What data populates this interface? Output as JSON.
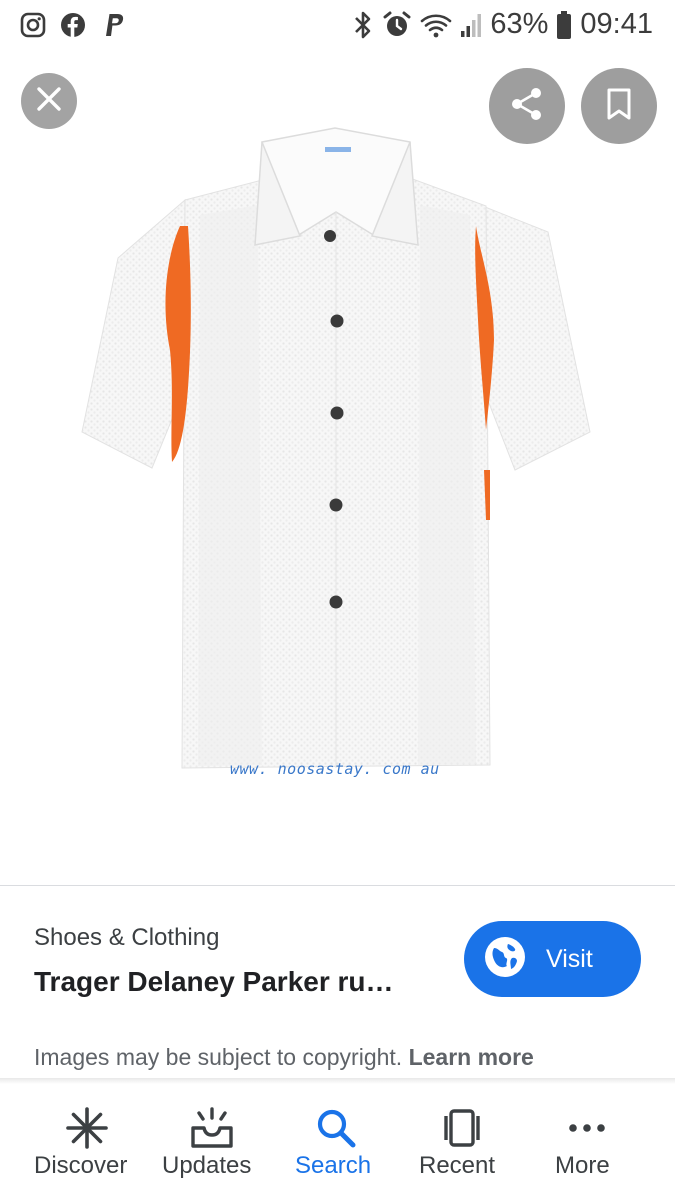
{
  "status_bar": {
    "left_icons": [
      "instagram-icon",
      "facebook-icon",
      "paypal-icon"
    ],
    "right_icons": [
      "bluetooth-icon",
      "alarm-icon",
      "wifi-icon",
      "signal-icon",
      "battery-icon"
    ],
    "battery": "63%",
    "time": "09:41"
  },
  "top_actions": {
    "close_icon": "close-icon",
    "share_icon": "share-icon",
    "bookmark_icon": "bookmark-icon"
  },
  "image": {
    "watermark": "www. noosastay. com au",
    "colors": {
      "shirt": "#f7f7f7",
      "stripe": "#ef6a23",
      "button": "#3a3a3a"
    }
  },
  "result": {
    "category": "Shoes & Clothing",
    "title": "Trager Delaney Parker ru…",
    "visit_label": "Visit",
    "visit_icon": "globe-icon",
    "copyright_text": "Images may be subject to copyright. ",
    "learn_more": "Learn more"
  },
  "bottom_nav": {
    "items": [
      {
        "label": "Discover",
        "icon": "asterisk-icon",
        "active": false
      },
      {
        "label": "Updates",
        "icon": "updates-icon",
        "active": false
      },
      {
        "label": "Search",
        "icon": "search-icon",
        "active": true
      },
      {
        "label": "Recent",
        "icon": "recent-icon",
        "active": false
      },
      {
        "label": "More",
        "icon": "more-icon",
        "active": false
      }
    ]
  },
  "colors": {
    "accent": "#1a73e8",
    "text_primary": "#202124",
    "text_secondary": "#5f6368"
  }
}
